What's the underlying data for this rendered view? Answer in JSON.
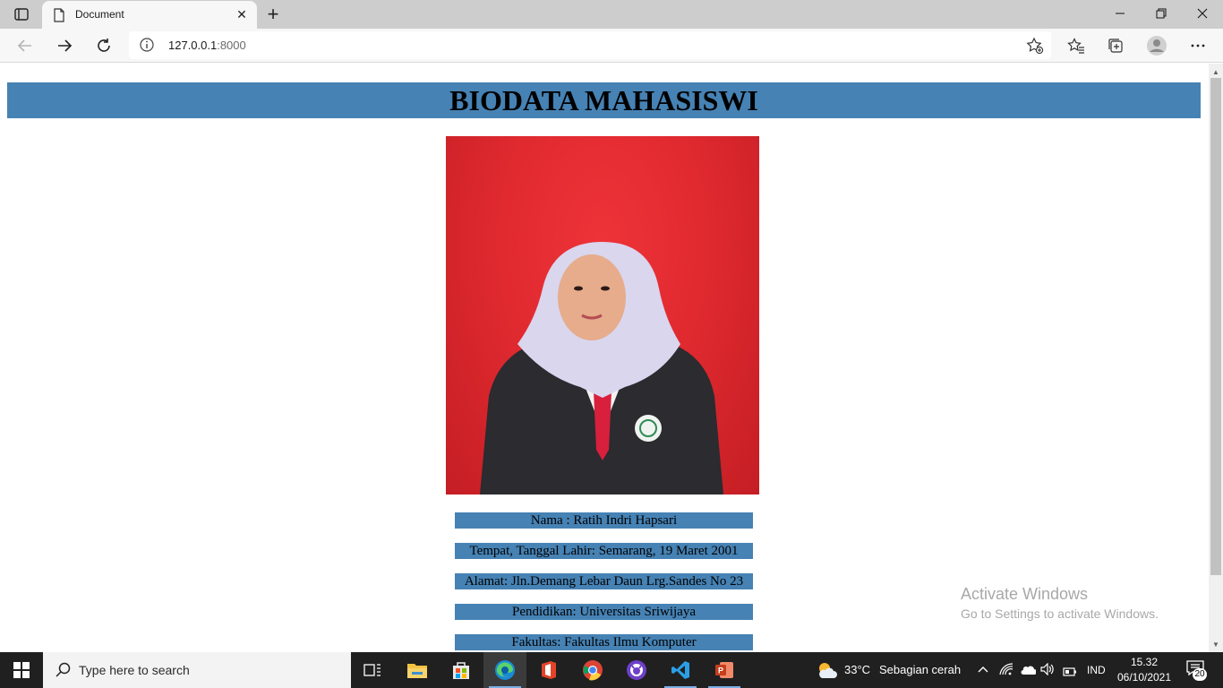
{
  "browser": {
    "tab_title": "Document",
    "tab_close": "✕",
    "new_tab": "+",
    "url_host": "127.0.0.1",
    "url_port": ":8000"
  },
  "page": {
    "heading": "BIODATA MAHASISWI",
    "photo_alt": "Foto mahasiswi",
    "rows": [
      "Nama : Ratih Indri Hapsari",
      "Tempat, Tanggal Lahir: Semarang, 19 Maret 2001",
      "Alamat: Jln.Demang Lebar Daun Lrg.Sandes No 23",
      "Pendidikan: Universitas Sriwijaya",
      "Fakultas: Fakultas Ilmu Komputer"
    ]
  },
  "watermark": {
    "line1": "Activate Windows",
    "line2": "Go to Settings to activate Windows."
  },
  "taskbar": {
    "search_placeholder": "Type here to search",
    "weather_temp": "33°C",
    "weather_desc": "Sebagian cerah",
    "language": "IND",
    "time": "15.32",
    "date": "06/10/2021",
    "notification_count": "20"
  },
  "colors": {
    "header_bg": "#4682b4",
    "row_bg": "#4682b4",
    "photo_bg": "#e02a30"
  }
}
